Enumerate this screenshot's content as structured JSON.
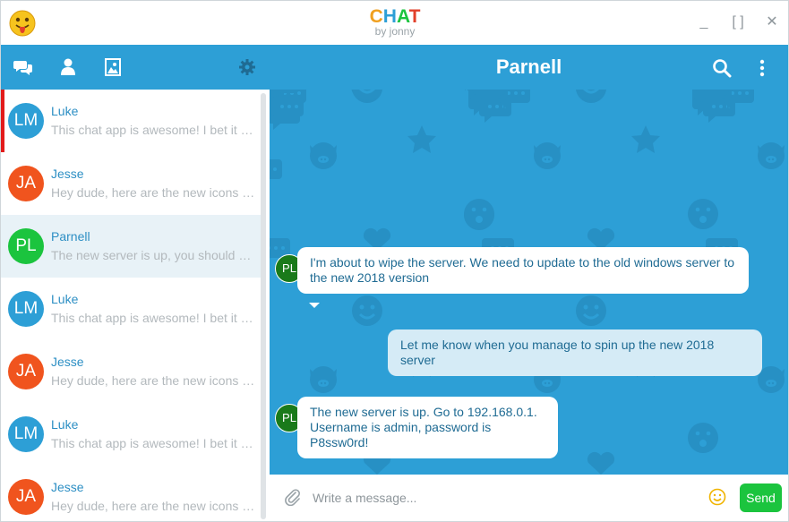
{
  "window": {
    "brand_letters": [
      {
        "char": "C",
        "color": "#f0a020"
      },
      {
        "char": "H",
        "color": "#2d9fd6"
      },
      {
        "char": "A",
        "color": "#1bc43e"
      },
      {
        "char": "T",
        "color": "#e2402b"
      }
    ],
    "brand_sub": "by jonny",
    "controls": [
      "_",
      "[ ]",
      "✕"
    ]
  },
  "toolbar": {
    "icons": [
      "chat-bubbles-icon",
      "user-icon",
      "image-icon",
      "gear-icon"
    ]
  },
  "contacts": [
    {
      "initials": "LM",
      "name": "Luke",
      "preview": "This chat app is awesome! I bet it will be a huge hit",
      "color": "#2d9fd6",
      "unread": true,
      "active": false
    },
    {
      "initials": "JA",
      "name": "Jesse",
      "preview": "Hey dude, here are the new icons for the app",
      "color": "#f0541e",
      "unread": false,
      "active": false
    },
    {
      "initials": "PL",
      "name": "Parnell",
      "preview": "The new server is up, you should go check it out",
      "color": "#1bc43e",
      "unread": false,
      "active": true
    },
    {
      "initials": "LM",
      "name": "Luke",
      "preview": "This chat app is awesome! I bet it will be a huge hit",
      "color": "#2d9fd6",
      "unread": false,
      "active": false
    },
    {
      "initials": "JA",
      "name": "Jesse",
      "preview": "Hey dude, here are the new icons for the app",
      "color": "#f0541e",
      "unread": false,
      "active": false
    },
    {
      "initials": "LM",
      "name": "Luke",
      "preview": "This chat app is awesome! I bet it will be a huge hit",
      "color": "#2d9fd6",
      "unread": false,
      "active": false
    },
    {
      "initials": "JA",
      "name": "Jesse",
      "preview": "Hey dude, here are the new icons for the app",
      "color": "#f0541e",
      "unread": false,
      "active": false
    }
  ],
  "chat": {
    "title": "Parnell",
    "header_icons": [
      "search-icon",
      "more-vertical-icon"
    ],
    "messages": [
      {
        "from": "them",
        "initials": "PL",
        "lines": [
          "I'm about to wipe the server. We need to update to the old windows server to",
          "the new 2018 version"
        ]
      },
      {
        "from": "me",
        "lines": [
          "Let me know when you manage to spin up the new 2018 server"
        ]
      },
      {
        "from": "them",
        "initials": "PL",
        "lines": [
          "The new server is up. Go to 192.168.0.1.",
          "Username is admin, password is P8ssw0rd!"
        ]
      }
    ]
  },
  "composer": {
    "placeholder": "Write a message...",
    "send_label": "Send"
  },
  "colors": {
    "primary": "#2d9fd6",
    "send": "#1bc43e",
    "unread_marker": "#e21b1b"
  }
}
